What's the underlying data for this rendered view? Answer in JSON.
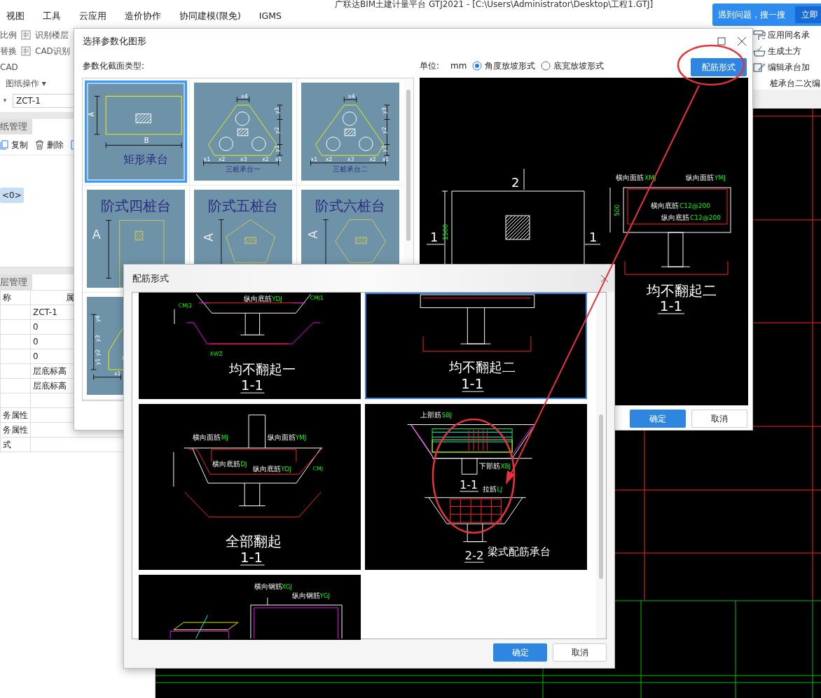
{
  "app": {
    "title": "广联达BIM土建计量平台 GTJ2021 - [C:\\Users\\Administrator\\Desktop\\工程1.GTJ]",
    "menu": [
      "视图",
      "工具",
      "云应用",
      "造价协作",
      "协同建模(限免)",
      "IGMS"
    ],
    "help": {
      "text": "遇到问题，搜一搜",
      "button": "立即"
    },
    "ribbon_left": [
      [
        {
          "label": "比例",
          "kind": "text"
        },
        {
          "label": "识别楼层",
          "kind": "icon"
        }
      ],
      [
        {
          "label": "替换",
          "kind": "text"
        },
        {
          "label": "CAD识别",
          "kind": "icon"
        }
      ],
      [
        {
          "label": "CAD",
          "kind": "text"
        }
      ],
      [
        {
          "label": "图纸操作",
          "kind": "dropdown",
          "caret": "▾"
        }
      ]
    ],
    "ribbon_right": [
      "应用同名承",
      "生成土方",
      "编辑承台加",
      "桩承台二次编"
    ],
    "left_panel": {
      "caret": "▾",
      "component": "ZCT-1",
      "drawings_tab": "纸管理",
      "actions": [
        "复制",
        "删除"
      ],
      "tree_item": {
        "label": "<0>",
        "selected": true
      },
      "layers_tab": "层管理",
      "properties": {
        "columns": [
          "称",
          "属"
        ],
        "rows": [
          [
            "",
            "ZCT-1"
          ],
          [
            "",
            "0"
          ],
          [
            "",
            "0"
          ],
          [
            "",
            "0"
          ],
          [
            "",
            "层底标高"
          ],
          [
            "",
            "层底标高"
          ],
          [
            "",
            ""
          ],
          [
            "务属性",
            ""
          ],
          [
            "务属性",
            ""
          ],
          [
            "式",
            ""
          ]
        ]
      }
    }
  },
  "param_dialog": {
    "title": "选择参数化图形",
    "section_label": "参数化截面类型:",
    "unit_label": "单位:",
    "unit": "mm",
    "slope_options": [
      {
        "label": "角度放坡形式",
        "selected": true
      },
      {
        "label": "底宽放坡形式",
        "selected": false
      }
    ],
    "rebar_button": "配筋形式",
    "shapes": [
      {
        "kind": "rect",
        "caption": "矩形承台",
        "labels": [
          "A",
          "B"
        ],
        "selected": true
      },
      {
        "kind": "tri",
        "caption": "三桩承台一",
        "labels": [
          "x4",
          "y3",
          "y2",
          "y1",
          "x1",
          "x2",
          "x3",
          "x2",
          "x1"
        ],
        "selected": false
      },
      {
        "kind": "tri",
        "caption": "三桩承台二",
        "labels": [
          "x4",
          "y3",
          "y2",
          "y1",
          "x1",
          "x2",
          "x3",
          "x2",
          "x1"
        ],
        "selected": false
      },
      {
        "kind": "step4",
        "caption": "阶式四桩台",
        "labels": [
          "A"
        ],
        "selected": false
      },
      {
        "kind": "step5",
        "caption": "阶式五桩台",
        "labels": [
          "A"
        ],
        "selected": false
      },
      {
        "kind": "step6",
        "caption": "阶式六桩台",
        "labels": [
          "A"
        ],
        "selected": false
      },
      {
        "kind": "multi",
        "labels": [
          "y4",
          "y3",
          "y2",
          "y1",
          "x1"
        ],
        "selected": false
      }
    ],
    "preview": {
      "caption": "均不翻起二",
      "section": "1-1",
      "labels": [
        {
          "text": "2",
          "kind": "text"
        },
        {
          "text": "1",
          "kind": "text"
        },
        {
          "text": "1",
          "kind": "text"
        },
        {
          "text": "1500",
          "kind": "code"
        },
        {
          "text": "横向面筋",
          "kind": "text"
        },
        {
          "text": "XMJ",
          "kind": "code"
        },
        {
          "text": "纵向面筋",
          "kind": "text"
        },
        {
          "text": "YMJ",
          "kind": "code"
        },
        {
          "text": "横向底筋",
          "kind": "text"
        },
        {
          "text": "C12@200",
          "kind": "code"
        },
        {
          "text": "纵向底筋",
          "kind": "text"
        },
        {
          "text": "C12@200",
          "kind": "code"
        },
        {
          "text": "500",
          "kind": "code"
        }
      ]
    },
    "buttons": [
      "确定",
      "取消"
    ]
  },
  "rebar_dialog": {
    "title": "配筋形式",
    "options": [
      {
        "kind": "none1",
        "caption": "均不翻起一",
        "sections": [
          "1-1"
        ],
        "selected": false,
        "labels": [
          {
            "text": "纵向底筋",
            "kind": "text"
          },
          {
            "text": "YDJ",
            "kind": "code"
          },
          {
            "text": "CMJ1",
            "kind": "code"
          },
          {
            "text": "CMJ2",
            "kind": "code"
          },
          {
            "text": "XWZ",
            "kind": "code"
          }
        ]
      },
      {
        "kind": "none2",
        "caption": "均不翻起二",
        "sections": [
          "1-1"
        ],
        "selected": true
      },
      {
        "kind": "all",
        "caption": "全部翻起",
        "sections": [
          "1-1"
        ],
        "selected": false,
        "labels": [
          {
            "text": "横向面筋",
            "kind": "text"
          },
          {
            "text": "MJ",
            "kind": "code"
          },
          {
            "text": "纵向面筋",
            "kind": "text"
          },
          {
            "text": "YMJ",
            "kind": "code"
          },
          {
            "text": "横向底筋",
            "kind": "text"
          },
          {
            "text": "DJ",
            "kind": "code"
          },
          {
            "text": "纵向底筋",
            "kind": "text"
          },
          {
            "text": "YDJ",
            "kind": "code"
          },
          {
            "text": "CMJ",
            "kind": "code"
          }
        ]
      },
      {
        "kind": "beam",
        "caption": "梁式配筋承台",
        "sections": [
          "1-1",
          "2-2"
        ],
        "selected": false,
        "labels": [
          {
            "text": "上部筋",
            "kind": "text"
          },
          {
            "text": "SBJ",
            "kind": "code"
          },
          {
            "text": "下部筋",
            "kind": "text"
          },
          {
            "text": "XBJ",
            "kind": "code"
          },
          {
            "text": "拉筋",
            "kind": "text"
          },
          {
            "text": "LJ",
            "kind": "code"
          }
        ]
      },
      {
        "kind": "grid",
        "selected": false,
        "labels": [
          {
            "text": "横向钢筋",
            "kind": "text"
          },
          {
            "text": "XGJ",
            "kind": "code"
          },
          {
            "text": "纵向钢筋",
            "kind": "text"
          },
          {
            "text": "YGJ",
            "kind": "code"
          }
        ]
      }
    ],
    "buttons": [
      "确定",
      "取消"
    ]
  }
}
